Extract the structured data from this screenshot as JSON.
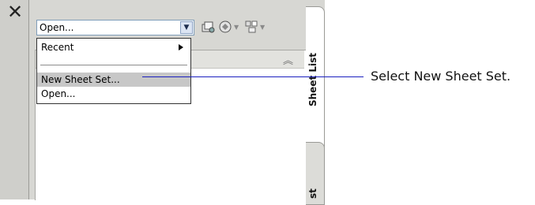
{
  "palette": {
    "close_symbol": "✕",
    "combo": {
      "value": "Open..."
    },
    "menu": {
      "items": [
        {
          "label": "Recent",
          "has_submenu": true
        },
        {
          "label": "New Sheet Set...",
          "selected": true
        },
        {
          "label": "Open..."
        }
      ]
    },
    "tabs": [
      {
        "label": "Sheet List"
      },
      {
        "label": "st"
      }
    ]
  },
  "callout": {
    "text": "Select New Sheet Set.",
    "line_color": "#1a1fbf"
  },
  "icons": [
    "close-icon",
    "dropdown-arrow-icon",
    "sheet-set-icon",
    "publish-icon",
    "layout-icon",
    "collapse-icon",
    "submenu-arrow-icon"
  ]
}
